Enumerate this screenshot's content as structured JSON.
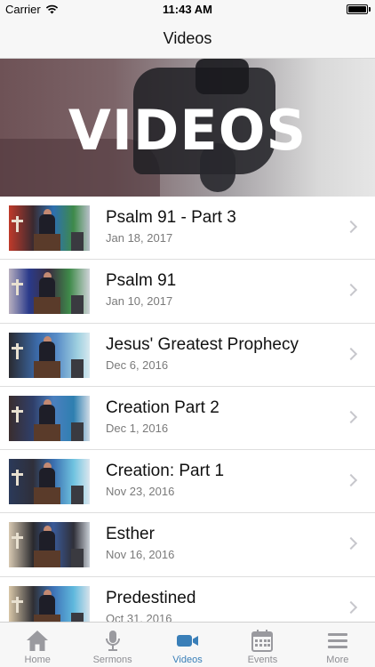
{
  "status_bar": {
    "carrier": "Carrier",
    "time": "11:43 AM"
  },
  "nav": {
    "title": "Videos"
  },
  "hero": {
    "text": "VIDEOS"
  },
  "videos": [
    {
      "title": "Psalm 91 -  Part 3",
      "date": "Jan 18, 2017"
    },
    {
      "title": "Psalm 91",
      "date": "Jan 10, 2017"
    },
    {
      "title": "Jesus' Greatest Prophecy",
      "date": "Dec 6, 2016"
    },
    {
      "title": "Creation Part 2",
      "date": "Dec 1, 2016"
    },
    {
      "title": "Creation: Part 1",
      "date": "Nov 23, 2016"
    },
    {
      "title": "Esther",
      "date": "Nov 16, 2016"
    },
    {
      "title": "Predestined",
      "date": "Oct 31, 2016"
    }
  ],
  "tabs": [
    {
      "label": "Home",
      "icon": "home-icon"
    },
    {
      "label": "Sermons",
      "icon": "microphone-icon"
    },
    {
      "label": "Videos",
      "icon": "video-camera-icon"
    },
    {
      "label": "Events",
      "icon": "calendar-icon"
    },
    {
      "label": "More",
      "icon": "menu-icon"
    }
  ],
  "colors": {
    "accent": "#3a7fb8",
    "tab_inactive": "#9a9a9f"
  }
}
